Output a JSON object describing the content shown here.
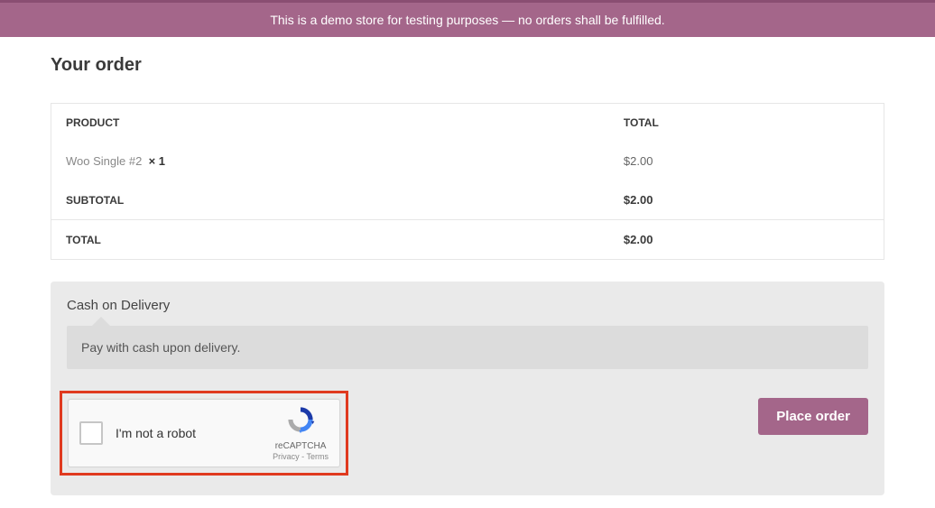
{
  "banner": {
    "text": "This is a demo store for testing purposes — no orders shall be fulfilled."
  },
  "order": {
    "title": "Your order",
    "headers": {
      "product": "PRODUCT",
      "total": "TOTAL"
    },
    "items": [
      {
        "name": "Woo Single #2",
        "qty": "× 1",
        "total": "$2.00"
      }
    ],
    "subtotal": {
      "label": "SUBTOTAL",
      "value": "$2.00"
    },
    "total": {
      "label": "TOTAL",
      "value": "$2.00"
    }
  },
  "payment": {
    "method_title": "Cash on Delivery",
    "method_desc": "Pay with cash upon delivery.",
    "place_order_label": "Place order"
  },
  "recaptcha": {
    "label": "I'm not a robot",
    "brand": "reCAPTCHA",
    "privacy": "Privacy",
    "terms": "Terms",
    "sep": " - "
  }
}
